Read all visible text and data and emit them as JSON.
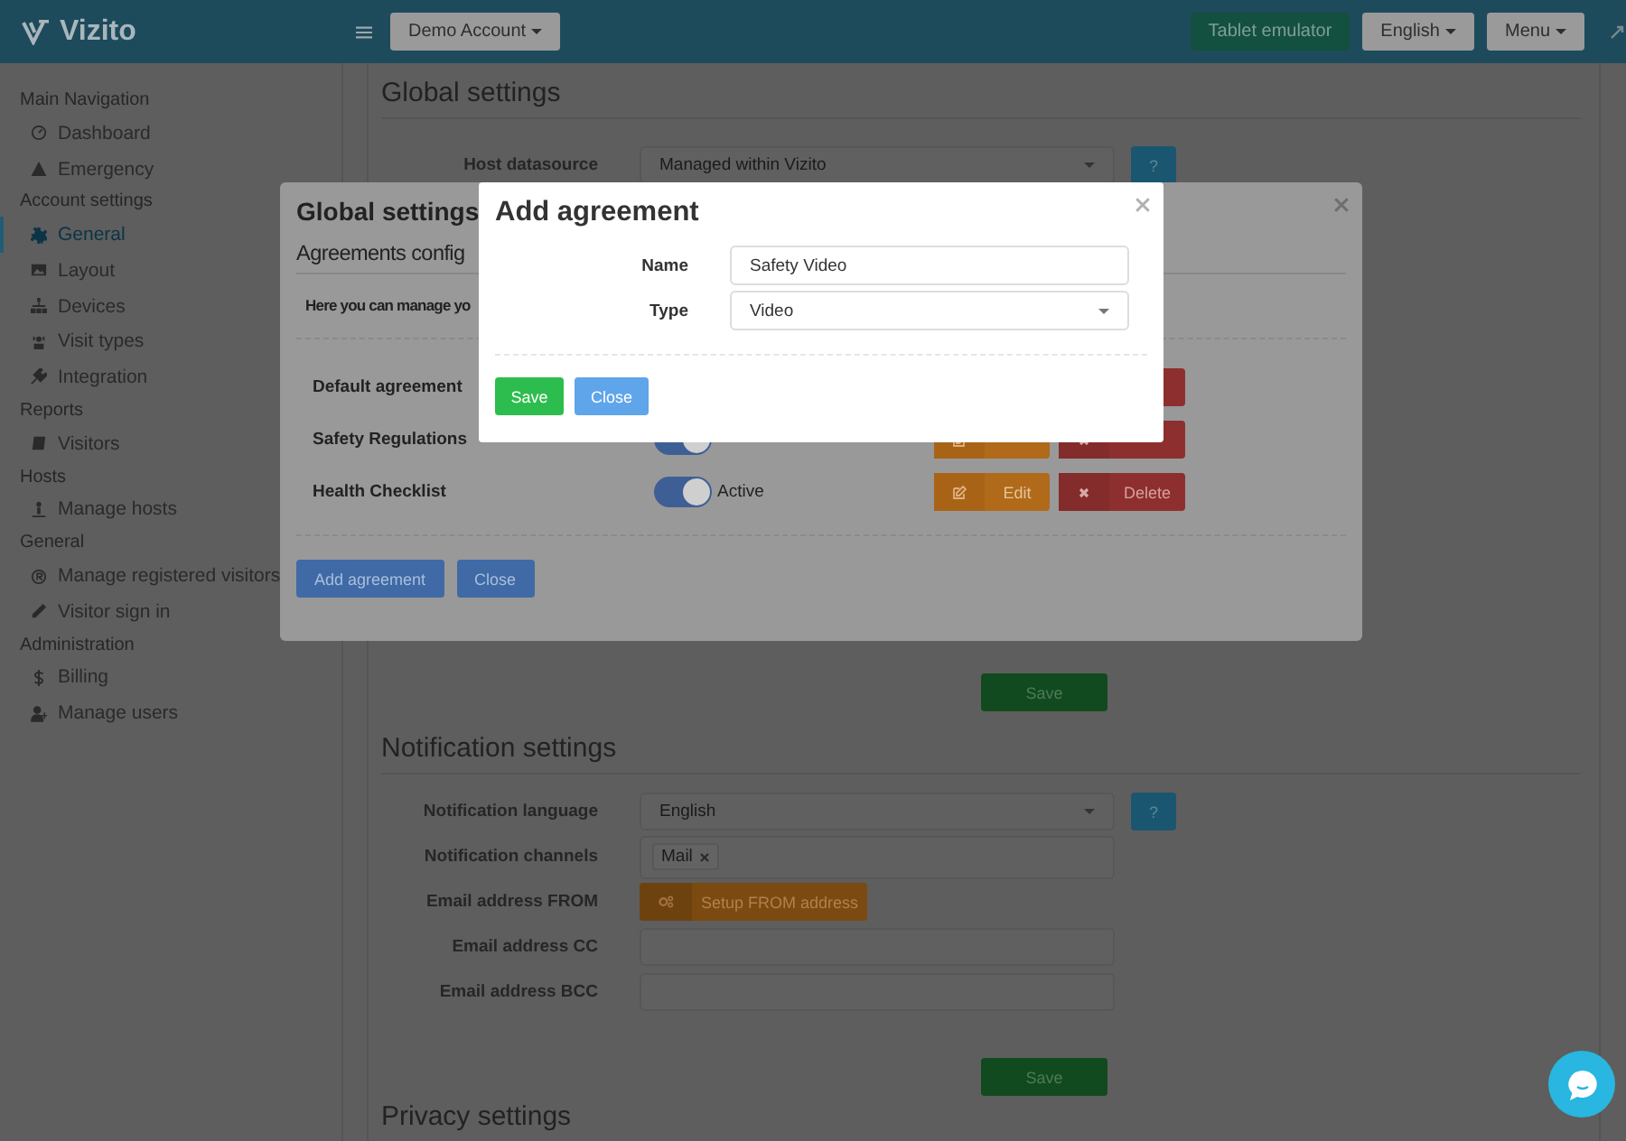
{
  "topbar": {
    "logo": "Vizito",
    "account": "Demo Account",
    "buttons": [
      {
        "label": "Tablet emulator",
        "kind": "primary"
      },
      {
        "label": "English",
        "kind": "dropdown"
      },
      {
        "label": "Menu",
        "kind": "dropdown"
      }
    ]
  },
  "sidebar": {
    "sections": [
      {
        "title": "Main Navigation",
        "items": [
          {
            "label": "Dashboard",
            "selected": false
          },
          {
            "label": "Emergency",
            "selected": false
          }
        ]
      },
      {
        "title": "Account settings",
        "items": [
          {
            "label": "General",
            "selected": true
          },
          {
            "label": "Layout",
            "selected": false
          },
          {
            "label": "Devices",
            "selected": false
          },
          {
            "label": "Visit types",
            "selected": false
          },
          {
            "label": "Integration",
            "selected": false
          }
        ]
      },
      {
        "title": "Reports",
        "items": [
          {
            "label": "Visitors",
            "selected": false
          }
        ]
      },
      {
        "title": "Hosts",
        "items": [
          {
            "label": "Manage hosts",
            "selected": false
          }
        ]
      },
      {
        "title": "General",
        "items": [
          {
            "label": "Manage registered visitors",
            "selected": false
          },
          {
            "label": "Visitor sign in",
            "selected": false
          }
        ]
      },
      {
        "title": "Administration",
        "items": [
          {
            "label": "Billing",
            "selected": false
          },
          {
            "label": "Manage users",
            "selected": false
          }
        ]
      }
    ]
  },
  "page": {
    "title": "Global settings",
    "host_row": {
      "label": "Host datasource",
      "value": "Managed within Vizito",
      "help": "?"
    },
    "save": "Save",
    "notifications": {
      "title": "Notification settings",
      "rows": [
        {
          "label": "Notification language",
          "kind": "select",
          "value": "English",
          "help": "?"
        },
        {
          "label": "Notification channels",
          "kind": "tags",
          "tags": [
            "Mail"
          ]
        },
        {
          "label": "Email address FROM",
          "kind": "button",
          "button": "Setup FROM address"
        },
        {
          "label": "Email address CC",
          "kind": "input"
        },
        {
          "label": "Email address BCC",
          "kind": "input"
        }
      ],
      "save": "Save"
    },
    "next_title": "Privacy settings"
  },
  "settings_modal": {
    "title": "Global settings",
    "subtitle": "Agreements config",
    "intro": "Here you can manage yo",
    "agreements": [
      {
        "name": "Default agreement"
      },
      {
        "name": "Safety Regulations",
        "active": true
      },
      {
        "name": "Health Checklist",
        "active": true,
        "status": "Active",
        "edit": "Edit",
        "delete": "Delete"
      }
    ],
    "buttons": [
      "Add agreement",
      "Close"
    ]
  },
  "agreement_modal": {
    "title": "Add agreement",
    "fields": [
      {
        "label": "Name",
        "kind": "input",
        "value": "Safety Video"
      },
      {
        "label": "Type",
        "kind": "select",
        "value": "Video"
      }
    ],
    "buttons": [
      {
        "label": "Save",
        "kind": "success"
      },
      {
        "label": "Close",
        "kind": "info"
      }
    ]
  }
}
